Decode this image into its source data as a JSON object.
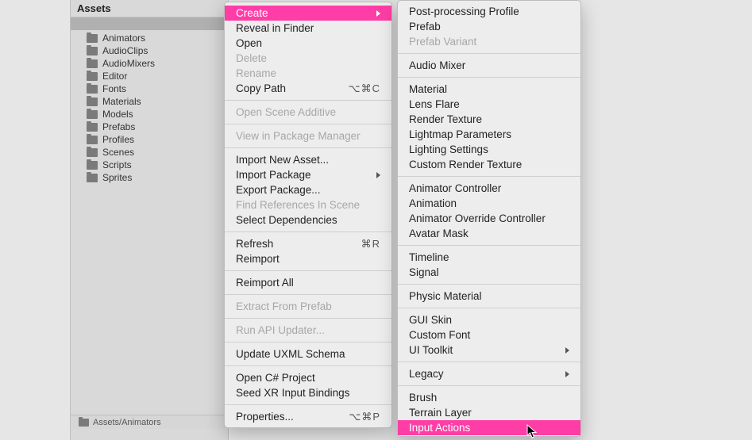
{
  "panel": {
    "title": "Assets",
    "folders": [
      "Animators",
      "AudioClips",
      "AudioMixers",
      "Editor",
      "Fonts",
      "Materials",
      "Models",
      "Prefabs",
      "Profiles",
      "Scenes",
      "Scripts",
      "Sprites"
    ],
    "breadcrumb": "Assets/Animators"
  },
  "menuA": [
    {
      "type": "item",
      "label": "Create",
      "highlight": true,
      "arrow": true
    },
    {
      "type": "item",
      "label": "Reveal in Finder"
    },
    {
      "type": "item",
      "label": "Open"
    },
    {
      "type": "item",
      "label": "Delete",
      "disabled": true
    },
    {
      "type": "item",
      "label": "Rename",
      "disabled": true
    },
    {
      "type": "item",
      "label": "Copy Path",
      "shortcut": "⌥⌘C"
    },
    {
      "type": "sep"
    },
    {
      "type": "item",
      "label": "Open Scene Additive",
      "disabled": true
    },
    {
      "type": "sep"
    },
    {
      "type": "item",
      "label": "View in Package Manager",
      "disabled": true
    },
    {
      "type": "sep"
    },
    {
      "type": "item",
      "label": "Import New Asset..."
    },
    {
      "type": "item",
      "label": "Import Package",
      "arrow": true
    },
    {
      "type": "item",
      "label": "Export Package..."
    },
    {
      "type": "item",
      "label": "Find References In Scene",
      "disabled": true
    },
    {
      "type": "item",
      "label": "Select Dependencies"
    },
    {
      "type": "sep"
    },
    {
      "type": "item",
      "label": "Refresh",
      "shortcut": "⌘R"
    },
    {
      "type": "item",
      "label": "Reimport"
    },
    {
      "type": "sep"
    },
    {
      "type": "item",
      "label": "Reimport All"
    },
    {
      "type": "sep"
    },
    {
      "type": "item",
      "label": "Extract From Prefab",
      "disabled": true
    },
    {
      "type": "sep"
    },
    {
      "type": "item",
      "label": "Run API Updater...",
      "disabled": true
    },
    {
      "type": "sep"
    },
    {
      "type": "item",
      "label": "Update UXML Schema"
    },
    {
      "type": "sep"
    },
    {
      "type": "item",
      "label": "Open C# Project"
    },
    {
      "type": "item",
      "label": "Seed XR Input Bindings"
    },
    {
      "type": "sep"
    },
    {
      "type": "item",
      "label": "Properties...",
      "shortcut": "⌥⌘P"
    }
  ],
  "menuB": [
    {
      "type": "item",
      "label": "Post-processing Profile"
    },
    {
      "type": "item",
      "label": "Prefab"
    },
    {
      "type": "item",
      "label": "Prefab Variant",
      "disabled": true
    },
    {
      "type": "sep"
    },
    {
      "type": "item",
      "label": "Audio Mixer"
    },
    {
      "type": "sep"
    },
    {
      "type": "item",
      "label": "Material"
    },
    {
      "type": "item",
      "label": "Lens Flare"
    },
    {
      "type": "item",
      "label": "Render Texture"
    },
    {
      "type": "item",
      "label": "Lightmap Parameters"
    },
    {
      "type": "item",
      "label": "Lighting Settings"
    },
    {
      "type": "item",
      "label": "Custom Render Texture"
    },
    {
      "type": "sep"
    },
    {
      "type": "item",
      "label": "Animator Controller"
    },
    {
      "type": "item",
      "label": "Animation"
    },
    {
      "type": "item",
      "label": "Animator Override Controller"
    },
    {
      "type": "item",
      "label": "Avatar Mask"
    },
    {
      "type": "sep"
    },
    {
      "type": "item",
      "label": "Timeline"
    },
    {
      "type": "item",
      "label": "Signal"
    },
    {
      "type": "sep"
    },
    {
      "type": "item",
      "label": "Physic Material"
    },
    {
      "type": "sep"
    },
    {
      "type": "item",
      "label": "GUI Skin"
    },
    {
      "type": "item",
      "label": "Custom Font"
    },
    {
      "type": "item",
      "label": "UI Toolkit",
      "arrow": true
    },
    {
      "type": "sep"
    },
    {
      "type": "item",
      "label": "Legacy",
      "arrow": true
    },
    {
      "type": "sep"
    },
    {
      "type": "item",
      "label": "Brush"
    },
    {
      "type": "item",
      "label": "Terrain Layer"
    },
    {
      "type": "item",
      "label": "Input Actions",
      "highlight": true
    }
  ]
}
